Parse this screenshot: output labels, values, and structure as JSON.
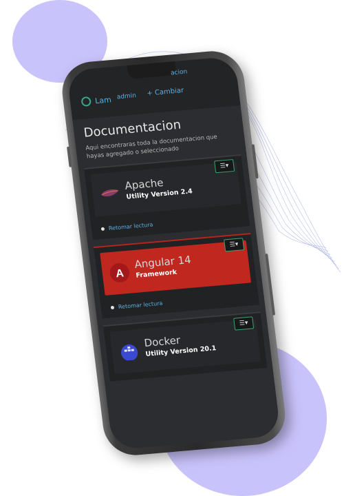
{
  "header": {
    "brand": "Lam",
    "user": "admin",
    "change_label": "+ Cambiar",
    "docs_link": "acion"
  },
  "page": {
    "title": "Documentacion",
    "description": "Aqui encontraras toda la documentacion que hayas agregado o seleccionado"
  },
  "cards": [
    {
      "name": "Apache",
      "subtitle": "Utility Version 2.4",
      "resume": "Retomar lectura",
      "icon": "feather-icon"
    },
    {
      "name": "Angular 14",
      "subtitle": "Framework",
      "resume": "Retomar lectura",
      "icon": "angular-icon"
    },
    {
      "name": "Docker",
      "subtitle": "Utility Version 20.1",
      "resume": "",
      "icon": "docker-icon"
    }
  ],
  "colors": {
    "accent": "#5fb0e0",
    "angular": "#c0271f",
    "blob": "#c9c3fb"
  }
}
